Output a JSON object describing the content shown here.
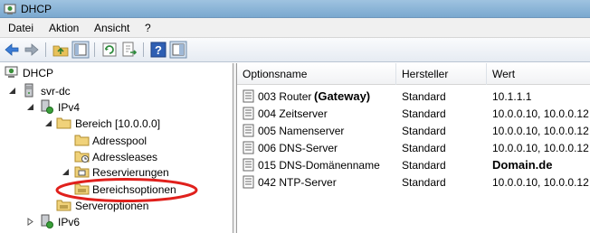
{
  "window": {
    "title": "DHCP"
  },
  "menu": [
    "Datei",
    "Aktion",
    "Ansicht",
    "?"
  ],
  "tree": {
    "root": "DHCP",
    "server": "svr-dc",
    "ipv4": "IPv4",
    "scope": "Bereich [10.0.0.0]",
    "address_pool": "Adresspool",
    "address_leases": "Adressleases",
    "reservations": "Reservierungen",
    "scope_options": "Bereichsoptionen",
    "server_options": "Serveroptionen",
    "ipv6": "IPv6"
  },
  "list": {
    "columns": [
      "Optionsname",
      "Hersteller",
      "Wert"
    ],
    "rows": [
      {
        "name": "003 Router",
        "annotation": "(Gateway)",
        "vendor": "Standard",
        "value": "10.1.1.1",
        "value_bold": false
      },
      {
        "name": "004 Zeitserver",
        "annotation": "",
        "vendor": "Standard",
        "value": "10.0.0.10, 10.0.0.12",
        "value_bold": false
      },
      {
        "name": "005 Namenserver",
        "annotation": "",
        "vendor": "Standard",
        "value": "10.0.0.10, 10.0.0.12",
        "value_bold": false
      },
      {
        "name": "006 DNS-Server",
        "annotation": "",
        "vendor": "Standard",
        "value": "10.0.0.10, 10.0.0.12",
        "value_bold": false
      },
      {
        "name": "015 DNS-Domänenname",
        "annotation": "",
        "vendor": "Standard",
        "value": "Domain.de",
        "value_bold": true
      },
      {
        "name": "042 NTP-Server",
        "annotation": "",
        "vendor": "Standard",
        "value": "10.0.0.10, 10.0.0.12",
        "value_bold": false
      }
    ]
  },
  "colors": {
    "annotation_ellipse": "#e0201c",
    "titlebar": "#9fc3e0"
  },
  "icons": [
    "dhcp-app-icon",
    "back-icon",
    "forward-icon",
    "up-folder-icon",
    "show-tree-icon",
    "refresh-icon",
    "export-icon",
    "help-icon",
    "action-pane-icon"
  ]
}
